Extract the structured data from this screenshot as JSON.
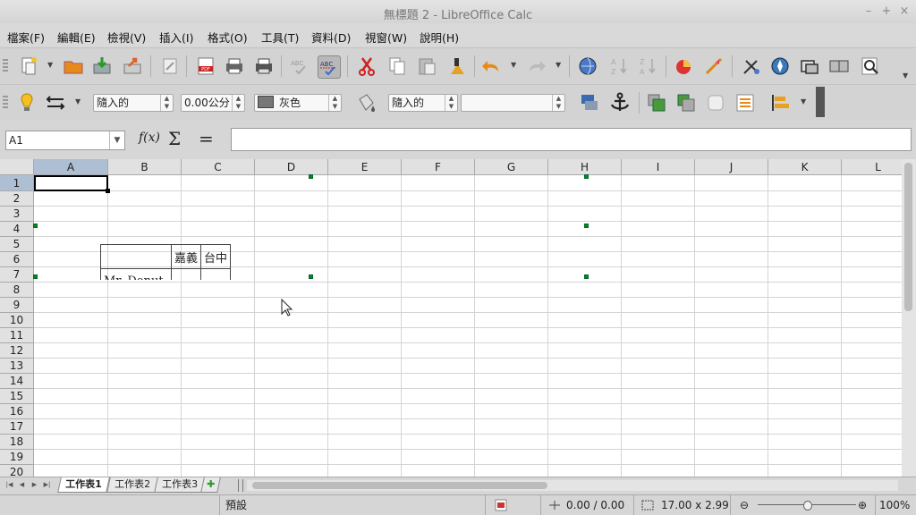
{
  "window": {
    "title": "無標題 2 - LibreOffice Calc"
  },
  "menu": [
    "檔案(F)",
    "編輯(E)",
    "檢視(V)",
    "插入(I)",
    "格式(O)",
    "工具(T)",
    "資料(D)",
    "視窗(W)",
    "說明(H)"
  ],
  "drawbar": {
    "wrap": "隨入的",
    "line_width": "0.00公分",
    "line_color": "灰色",
    "area_style": "隨入的",
    "area_value": ""
  },
  "formula": {
    "name_box": "A1",
    "content": ""
  },
  "columns": [
    "A",
    "B",
    "C",
    "D",
    "E",
    "F",
    "G",
    "H",
    "I",
    "J",
    "K",
    "L"
  ],
  "rows": [
    "1",
    "2",
    "3",
    "4",
    "5",
    "6",
    "7",
    "8",
    "9",
    "10",
    "11",
    "12",
    "13",
    "14",
    "15",
    "16",
    "17",
    "18",
    "19",
    "20"
  ],
  "selection": {
    "cell": "A1",
    "column": "A",
    "row": "1"
  },
  "embedded_table": {
    "header": [
      "",
      "嘉義",
      "台中"
    ],
    "row_label": "Mr. Donut"
  },
  "sheets": [
    "工作表1",
    "工作表2",
    "工作表3"
  ],
  "active_sheet": "工作表1",
  "status": {
    "page_style": "預設",
    "position": "0.00 / 0.00",
    "size": "17.00 x 2.99",
    "zoom": "100%",
    "zoom_level": 0.5
  },
  "colors": {
    "accent_selection": "#aebfd3",
    "handle": "#0a8a0a"
  }
}
